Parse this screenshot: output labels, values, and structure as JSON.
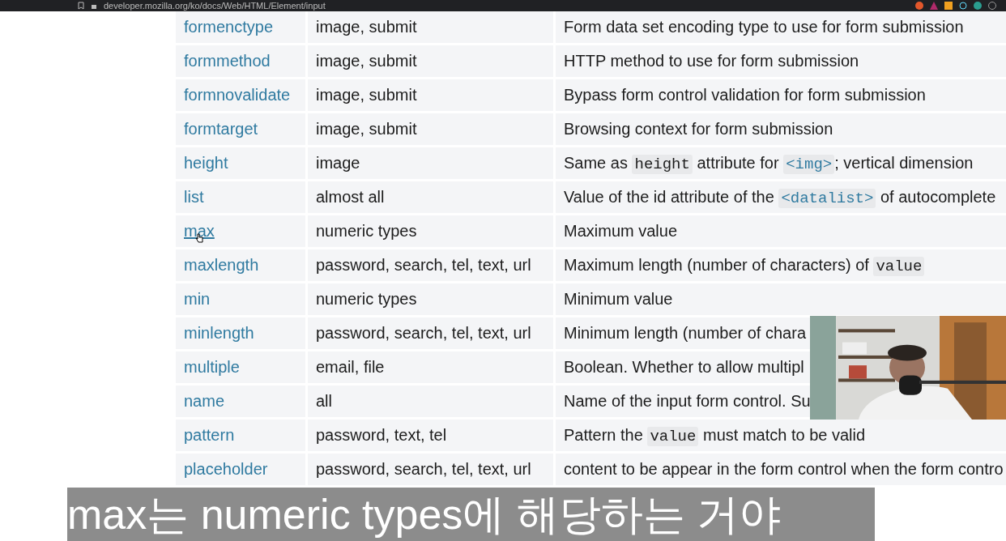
{
  "browser": {
    "url": "developer.mozilla.org/ko/docs/Web/HTML/Element/input"
  },
  "table": {
    "rows": [
      {
        "attribute": "formenctype",
        "hovered": false,
        "types": "image, submit",
        "description": [
          {
            "kind": "text",
            "text": "Form data set encoding type to use for form submission"
          }
        ]
      },
      {
        "attribute": "formmethod",
        "hovered": false,
        "types": "image, submit",
        "description": [
          {
            "kind": "text",
            "text": "HTTP method to use for form submission"
          }
        ]
      },
      {
        "attribute": "formnovalidate",
        "hovered": false,
        "types": "image, submit",
        "description": [
          {
            "kind": "text",
            "text": "Bypass form control validation for form submission"
          }
        ]
      },
      {
        "attribute": "formtarget",
        "hovered": false,
        "types": "image, submit",
        "description": [
          {
            "kind": "text",
            "text": "Browsing context for form submission"
          }
        ]
      },
      {
        "attribute": "height",
        "hovered": false,
        "types": "image",
        "description": [
          {
            "kind": "text",
            "text": "Same as "
          },
          {
            "kind": "code",
            "text": "height"
          },
          {
            "kind": "text",
            "text": " attribute for "
          },
          {
            "kind": "link",
            "text": "<img>"
          },
          {
            "kind": "text",
            "text": "; vertical dimension"
          }
        ]
      },
      {
        "attribute": "list",
        "hovered": false,
        "types": "almost all",
        "description": [
          {
            "kind": "text",
            "text": "Value of the id attribute of the "
          },
          {
            "kind": "link",
            "text": "<datalist>"
          },
          {
            "kind": "text",
            "text": " of autocomplete"
          }
        ]
      },
      {
        "attribute": "max",
        "hovered": true,
        "types": "numeric types",
        "description": [
          {
            "kind": "text",
            "text": "Maximum value"
          }
        ]
      },
      {
        "attribute": "maxlength",
        "hovered": false,
        "types": "password, search, tel, text, url",
        "description": [
          {
            "kind": "text",
            "text": "Maximum length (number of characters) of "
          },
          {
            "kind": "code",
            "text": "value"
          }
        ]
      },
      {
        "attribute": "min",
        "hovered": false,
        "types": "numeric types",
        "description": [
          {
            "kind": "text",
            "text": "Minimum value"
          }
        ]
      },
      {
        "attribute": "minlength",
        "hovered": false,
        "types": "password, search, tel, text, url",
        "description": [
          {
            "kind": "text",
            "text": "Minimum length (number of chara"
          }
        ]
      },
      {
        "attribute": "multiple",
        "hovered": false,
        "types": "email, file",
        "description": [
          {
            "kind": "text",
            "text": "Boolean. Whether to allow multipl"
          }
        ]
      },
      {
        "attribute": "name",
        "hovered": false,
        "types": "all",
        "description": [
          {
            "kind": "text",
            "text": "Name of the input form control. Su"
          }
        ]
      },
      {
        "attribute": "pattern",
        "hovered": false,
        "types": "password, text, tel",
        "description": [
          {
            "kind": "text",
            "text": "Pattern the "
          },
          {
            "kind": "code",
            "text": "value"
          },
          {
            "kind": "text",
            "text": " must match to be valid"
          }
        ]
      },
      {
        "attribute": "placeholder",
        "hovered": false,
        "types": "password, search, tel, text, url",
        "description": [
          {
            "kind": "text",
            "text": "content to be appear in the form control when the form contro"
          }
        ]
      }
    ]
  },
  "subtitle": "max는 numeric types에 해당하는 거야"
}
